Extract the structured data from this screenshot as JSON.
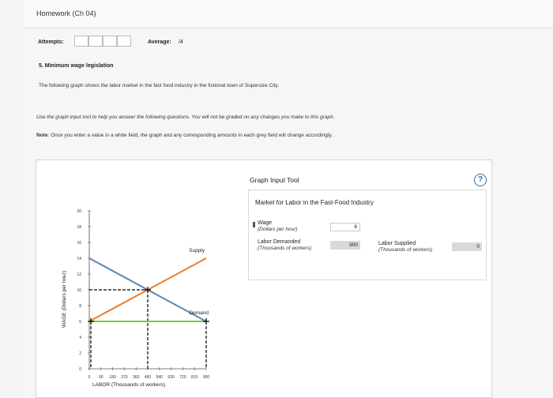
{
  "app": {
    "title": "Homework (Ch 04)"
  },
  "header": {
    "attempts_label": "Attempts:",
    "average_label": "Average:",
    "average_value": "/4"
  },
  "question": {
    "title": "5. Minimum wage legislation",
    "description": "The following graph shows the labor market in the fast food industry in the fictional town of Supersize City.",
    "instructions": "Use the graph input tool to help you answer the following questions. You will not be graded on any changes you make to this graph.",
    "note_label": "Note",
    "note_text": ": Once you enter a value in a white field, the graph and any corresponding amounts in each grey field will change accordingly."
  },
  "tool": {
    "title": "Graph Input Tool",
    "help_icon": "?",
    "market_title": "Market for Labor in the Fast-Food Industry",
    "wage_label": "Wage",
    "wage_sub": "(Dollars per hour)",
    "wage_value": "6",
    "demanded_label": "Labor Demanded",
    "demanded_sub": "(Thousands of workers)",
    "demanded_value": "900",
    "supplied_label": "Labor Supplied",
    "supplied_sub": "(Thousands of workers)",
    "supplied_value": "0"
  },
  "chart_data": {
    "type": "line",
    "xlabel": "LABOR (Thousands of workers)",
    "ylabel": "WAGE (Dollars per hour)",
    "xlim": [
      0,
      900
    ],
    "ylim": [
      0,
      20
    ],
    "x_ticks": [
      "0",
      "90",
      "180",
      "270",
      "360",
      "450",
      "540",
      "630",
      "720",
      "810",
      "900"
    ],
    "y_ticks": [
      "0",
      "2",
      "4",
      "6",
      "8",
      "10",
      "12",
      "14",
      "16",
      "18",
      "20"
    ],
    "series": [
      {
        "name": "Supply",
        "color": "#f07c24",
        "points": [
          [
            0,
            6
          ],
          [
            900,
            14
          ]
        ]
      },
      {
        "name": "Demand",
        "color": "#5b87b5",
        "points": [
          [
            0,
            14
          ],
          [
            900,
            6
          ]
        ]
      }
    ],
    "wage_line": {
      "color": "#7cc242",
      "y": 6,
      "x_range": [
        0,
        900
      ]
    },
    "equilibrium": {
      "x": 450,
      "y": 10
    },
    "grid": false
  }
}
